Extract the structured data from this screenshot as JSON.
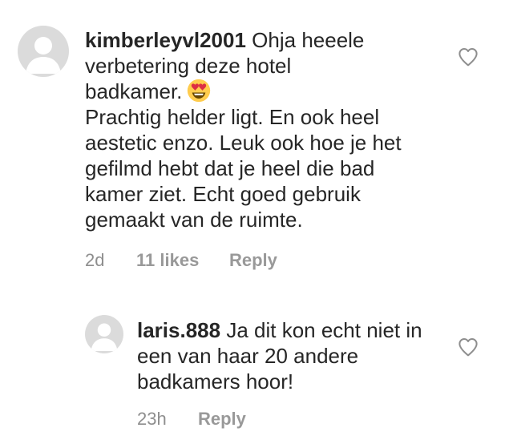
{
  "comments": [
    {
      "username": "kimberleyvl2001",
      "text_line1": "Ohja heeele",
      "text_line2": "verbetering deze hotel",
      "text_line3": "badkamer.",
      "emoji": "heart-eyes-emoji",
      "text_para2": "Prachtig helder ligt. En ook heel aestetic enzo. Leuk ook hoe je het gefilmd hebt dat je heel die bad kamer ziet. Echt goed gebruik gemaakt van de ruimte.",
      "time": "2d",
      "likes": "11 likes",
      "reply_label": "Reply"
    },
    {
      "username": "laris.888",
      "text": "Ja dit kon echt niet in een van haar 20 andere badkamers hoor!",
      "time": "23h",
      "reply_label": "Reply"
    }
  ],
  "icons": {
    "like": "heart-outline-icon",
    "avatar": "default-avatar-icon"
  },
  "colors": {
    "text": "#262626",
    "meta": "#8e8e8e",
    "avatar_bg": "#dbdbdb"
  }
}
